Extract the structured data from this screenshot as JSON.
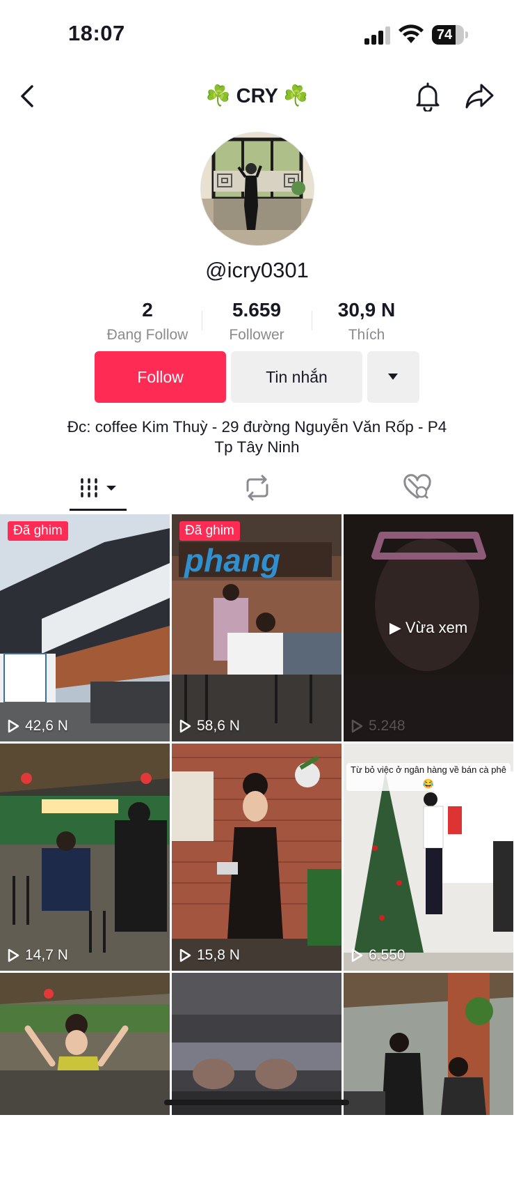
{
  "status_bar": {
    "time": "18:07",
    "battery": "74",
    "battery_level": 0.74
  },
  "header": {
    "title": "☘️ CRY ☘️"
  },
  "profile": {
    "handle": "@icry0301",
    "stats": [
      {
        "value": "2",
        "label": "Đang Follow"
      },
      {
        "value": "5.659",
        "label": "Follower"
      },
      {
        "value": "30,9 N",
        "label": "Thích"
      }
    ],
    "follow_label": "Follow",
    "message_label": "Tin nhắn",
    "bio_line1": "Đc: coffee Kim Thuỳ - 29 đường Nguyễn Văn Rốp - P4",
    "bio_line2": "Tp Tây Ninh"
  },
  "videos": [
    {
      "pinned": "Đã ghim",
      "views": "42,6 N"
    },
    {
      "pinned": "Đã ghim",
      "views": "58,6 N"
    },
    {
      "views": "5.248",
      "watched_label": "Vừa xem"
    },
    {
      "views": "14,7 N"
    },
    {
      "views": "15,8 N"
    },
    {
      "views": "6.550",
      "overlay": "Từ bỏ việc ở ngân hàng về bán cà phê 😂"
    },
    {
      "views": ""
    },
    {
      "views": ""
    },
    {
      "views": ""
    }
  ],
  "colors": {
    "accent": "#fe2c55",
    "text": "#161823",
    "secondary": "#8a8b91"
  }
}
